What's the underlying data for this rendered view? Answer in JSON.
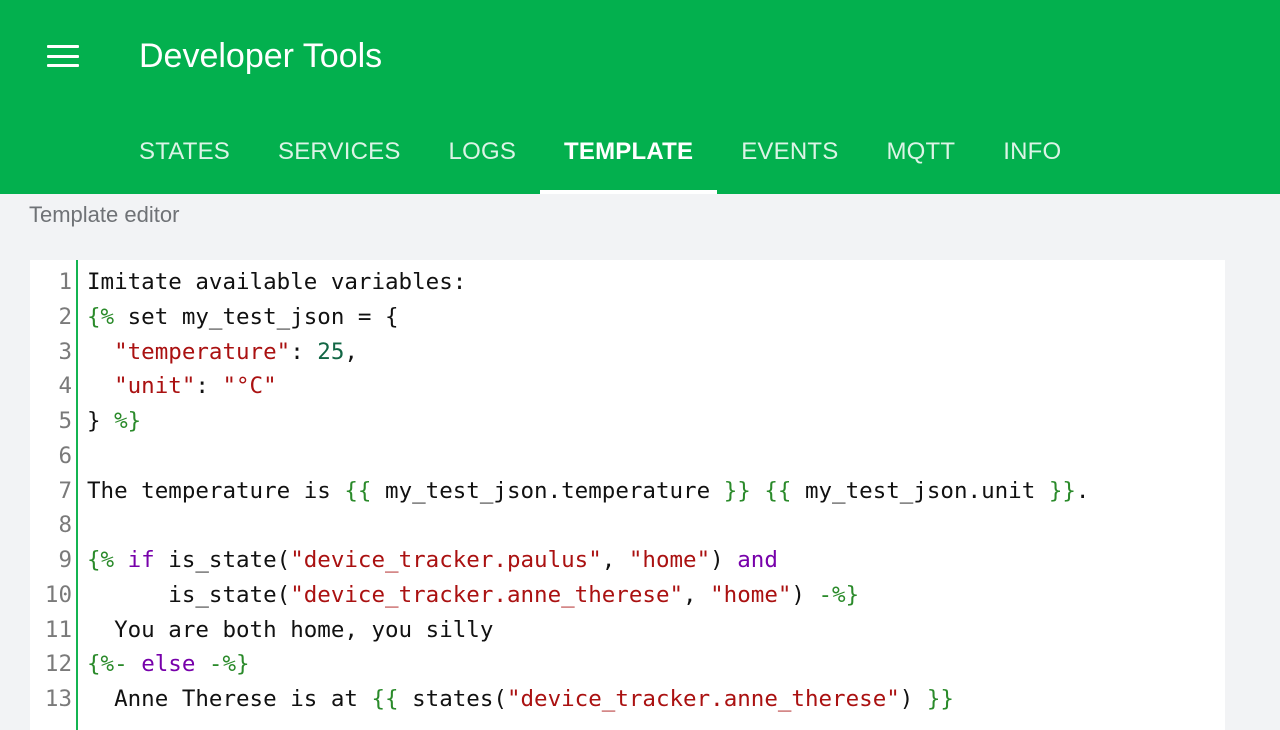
{
  "header": {
    "title": "Developer Tools",
    "menu_icon": "hamburger-menu-icon"
  },
  "tabs": [
    {
      "label": "STATES",
      "active": false
    },
    {
      "label": "SERVICES",
      "active": false
    },
    {
      "label": "LOGS",
      "active": false
    },
    {
      "label": "TEMPLATE",
      "active": true
    },
    {
      "label": "EVENTS",
      "active": false
    },
    {
      "label": "MQTT",
      "active": false
    },
    {
      "label": "INFO",
      "active": false
    }
  ],
  "editor": {
    "label": "Template editor",
    "lines": [
      {
        "number": "1",
        "tokens": [
          {
            "t": "Imitate available variables:",
            "c": "text"
          }
        ]
      },
      {
        "number": "2",
        "tokens": [
          {
            "t": "{%",
            "c": "delim"
          },
          {
            "t": " set my_test_json = {",
            "c": "text"
          }
        ]
      },
      {
        "number": "3",
        "tokens": [
          {
            "t": "  ",
            "c": "text"
          },
          {
            "t": "\"temperature\"",
            "c": "str"
          },
          {
            "t": ": ",
            "c": "text"
          },
          {
            "t": "25",
            "c": "num"
          },
          {
            "t": ",",
            "c": "text"
          }
        ]
      },
      {
        "number": "4",
        "tokens": [
          {
            "t": "  ",
            "c": "text"
          },
          {
            "t": "\"unit\"",
            "c": "str"
          },
          {
            "t": ": ",
            "c": "text"
          },
          {
            "t": "\"°C\"",
            "c": "str"
          }
        ]
      },
      {
        "number": "5",
        "tokens": [
          {
            "t": "} ",
            "c": "text"
          },
          {
            "t": "%}",
            "c": "delim"
          }
        ]
      },
      {
        "number": "6",
        "tokens": []
      },
      {
        "number": "7",
        "tokens": [
          {
            "t": "The temperature is ",
            "c": "text"
          },
          {
            "t": "{{",
            "c": "delim"
          },
          {
            "t": " my_test_json.temperature ",
            "c": "text"
          },
          {
            "t": "}}",
            "c": "delim"
          },
          {
            "t": " ",
            "c": "text"
          },
          {
            "t": "{{",
            "c": "delim"
          },
          {
            "t": " my_test_json.unit ",
            "c": "text"
          },
          {
            "t": "}}",
            "c": "delim"
          },
          {
            "t": ".",
            "c": "text"
          }
        ]
      },
      {
        "number": "8",
        "tokens": []
      },
      {
        "number": "9",
        "tokens": [
          {
            "t": "{%",
            "c": "delim"
          },
          {
            "t": " ",
            "c": "text"
          },
          {
            "t": "if",
            "c": "kw"
          },
          {
            "t": " is_state(",
            "c": "text"
          },
          {
            "t": "\"device_tracker.paulus\"",
            "c": "str"
          },
          {
            "t": ", ",
            "c": "text"
          },
          {
            "t": "\"home\"",
            "c": "str"
          },
          {
            "t": ") ",
            "c": "text"
          },
          {
            "t": "and",
            "c": "kw"
          }
        ]
      },
      {
        "number": "10",
        "tokens": [
          {
            "t": "      is_state(",
            "c": "text"
          },
          {
            "t": "\"device_tracker.anne_therese\"",
            "c": "str"
          },
          {
            "t": ", ",
            "c": "text"
          },
          {
            "t": "\"home\"",
            "c": "str"
          },
          {
            "t": ") ",
            "c": "text"
          },
          {
            "t": "-%}",
            "c": "delim"
          }
        ]
      },
      {
        "number": "11",
        "tokens": [
          {
            "t": "  You are both home, you silly",
            "c": "text"
          }
        ]
      },
      {
        "number": "12",
        "tokens": [
          {
            "t": "{%-",
            "c": "delim"
          },
          {
            "t": " ",
            "c": "text"
          },
          {
            "t": "else",
            "c": "kw"
          },
          {
            "t": " ",
            "c": "text"
          },
          {
            "t": "-%}",
            "c": "delim"
          }
        ]
      },
      {
        "number": "13",
        "tokens": [
          {
            "t": "  Anne Therese is at ",
            "c": "text"
          },
          {
            "t": "{{",
            "c": "delim"
          },
          {
            "t": " states(",
            "c": "text"
          },
          {
            "t": "\"device_tracker.anne_therese\"",
            "c": "str"
          },
          {
            "t": ") ",
            "c": "text"
          },
          {
            "t": "}}",
            "c": "delim"
          }
        ]
      }
    ]
  },
  "colors": {
    "header_bg": "#03b04e",
    "page_bg": "#f2f3f5",
    "gutter_border": "#14b451",
    "delimiter": "#2a8a2a",
    "string": "#aa1111",
    "number": "#116644",
    "keyword": "#7700aa"
  }
}
